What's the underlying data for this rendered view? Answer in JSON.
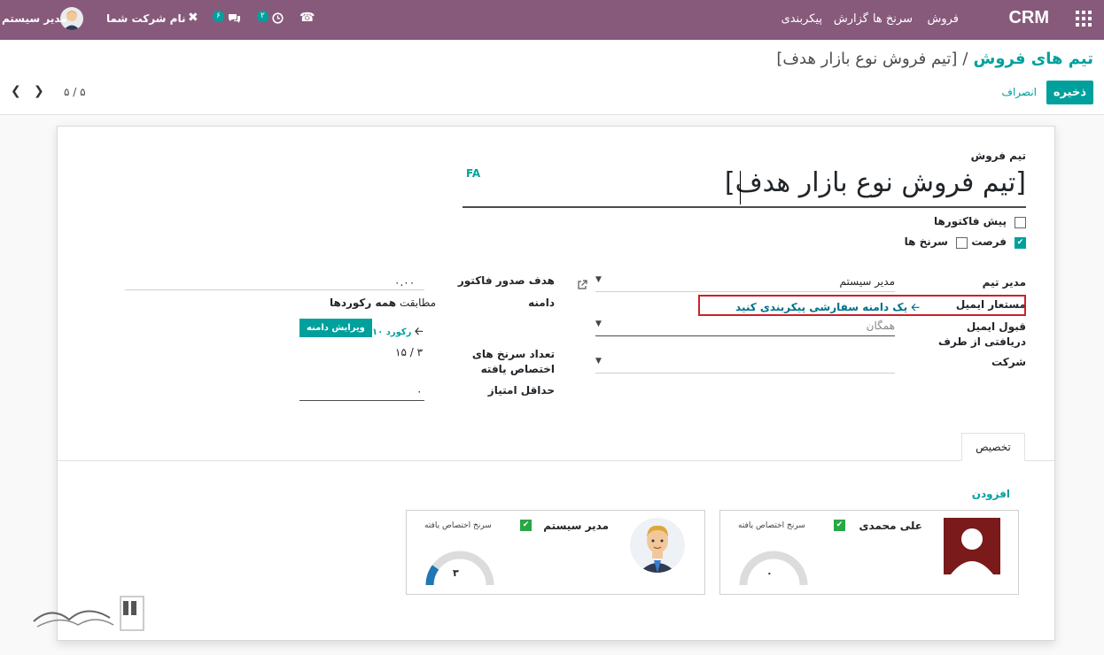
{
  "navbar": {
    "brand": "CRM",
    "menu": [
      "فروش",
      "سرنخ ها",
      "گزارش",
      "پیکربندی"
    ],
    "activity_count": "۲",
    "messages_count": "۶",
    "company": "نام شرکت شما",
    "user": "مدیر سیستم"
  },
  "control_panel": {
    "breadcrumb_parent": "تیم های فروش",
    "breadcrumb_sep": "/",
    "breadcrumb_current": "[تیم فروش نوع بازار هدف]",
    "save_label": "ذخیره",
    "discard_label": "انصراف",
    "pager": "۵ / ۵"
  },
  "form": {
    "title_label": "تیم فروش",
    "title_value": "[تیم فروش نوع بازار هدف]",
    "lang_tag": "FA",
    "checkboxes": [
      {
        "label": "پیش فاکتورها",
        "checked": false
      },
      {
        "label": "فرصت",
        "checked": true
      },
      {
        "label": "سرنخ ها",
        "checked": false
      }
    ],
    "team_leader_label": "مدیر تیم",
    "team_leader_value": "مدیر سیستم",
    "alias_label": "مستعار ایمیل",
    "alias_link": "یک دامنه سفارشی پیکربندی کنید",
    "accept_from_label": "قبول ایمیل دریافتی از طرف",
    "accept_from_value": "همگان",
    "company_label": "شرکت",
    "invoice_target_label": "هدف صدور فاکتور",
    "invoice_target_value": "۰.۰۰",
    "domain_label": "دامنه",
    "domain_match_prefix": "مطابقت",
    "domain_match_value": "همه رکوردها",
    "records_link": "۱۰ رکورد",
    "edit_domain_label": "ویرایش دامنه",
    "assigned_leads_label": "تعداد سرنخ های اختصاص یافته",
    "assigned_leads_value": "۳ / ۱۵",
    "min_score_label": "حداقل امتیاز",
    "min_score_value": "۰"
  },
  "tabs": {
    "assignment": "تخصیص"
  },
  "assignment": {
    "add_label": "افزودن",
    "members": [
      {
        "name": "علی محمدی",
        "caption": "سرنخ اختصاص یافته",
        "value": "۰",
        "fill": 0
      },
      {
        "name": "مدیر سیستم",
        "caption": "سرنخ اختصاص یافته",
        "value": "۳",
        "fill": 0.2
      }
    ]
  },
  "colors": {
    "primary": "#875a7b",
    "accent": "#00a09d",
    "highlight": "#d01e2a"
  }
}
